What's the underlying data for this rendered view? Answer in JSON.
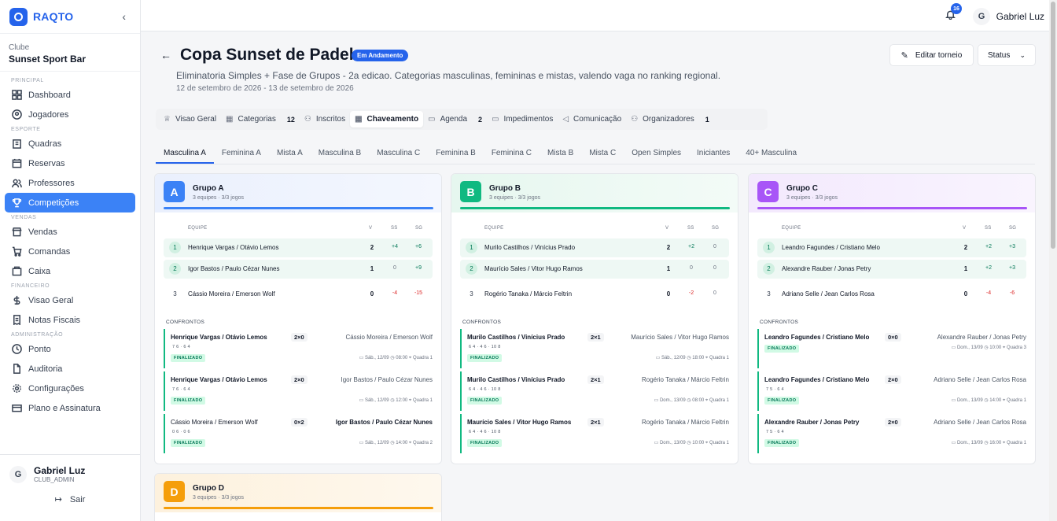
{
  "brand": {
    "name": "RAQTO"
  },
  "club": {
    "label": "Clube",
    "name": "Sunset Sport Bar"
  },
  "nav": {
    "sections": {
      "principal": "PRINCIPAL",
      "esporte": "ESPORTE",
      "vendas": "VENDAS",
      "financeiro": "FINANCEIRO",
      "administracao": "ADMINISTRAÇÃO"
    },
    "items": {
      "dashboard": "Dashboard",
      "jogadores": "Jogadores",
      "quadras": "Quadras",
      "reservas": "Reservas",
      "professores": "Professores",
      "competicoes": "Competições",
      "vendas": "Vendas",
      "comandas": "Comandas",
      "caixa": "Caixa",
      "visao_geral": "Visao Geral",
      "notas_fiscais": "Notas Fiscais",
      "ponto": "Ponto",
      "auditoria": "Auditoria",
      "configuracoes": "Configurações",
      "plano": "Plano e Assinatura"
    }
  },
  "user": {
    "initial": "G",
    "name": "Gabriel Luz",
    "role": "CLUB_ADMIN",
    "logout": "Sair"
  },
  "topbar": {
    "notifications": "16",
    "initial": "G",
    "name": "Gabriel Luz"
  },
  "header": {
    "title": "Copa Sunset de Padel",
    "status": "Em Andamento",
    "description": "Eliminatoria Simples + Fase de Grupos - 2a edicao. Categorias masculinas, femininas e mistas, valendo vaga no ranking regional.",
    "dates": "12 de setembro de 2026 - 13 de setembro de 2026",
    "edit_button": "Editar torneio",
    "status_button": "Status"
  },
  "main_tabs": [
    {
      "label": "Visao Geral",
      "count": ""
    },
    {
      "label": "Categorias",
      "count": "12"
    },
    {
      "label": "Inscritos",
      "count": ""
    },
    {
      "label": "Chaveamento",
      "count": ""
    },
    {
      "label": "Agenda",
      "count": "2"
    },
    {
      "label": "Impedimentos",
      "count": ""
    },
    {
      "label": "Comunicação",
      "count": ""
    },
    {
      "label": "Organizadores",
      "count": "1"
    }
  ],
  "category_tabs": [
    "Masculina A",
    "Feminina A",
    "Mista A",
    "Masculina B",
    "Masculina C",
    "Feminina B",
    "Feminina C",
    "Mista B",
    "Mista C",
    "Open Simples",
    "Iniciantes",
    "40+ Masculina"
  ],
  "table_headers": {
    "team": "EQUIPE",
    "v": "V",
    "ss": "SS",
    "sg": "SG",
    "confrontos": "CONFRONTOS",
    "finalizado": "FINALIZADO"
  },
  "colors": {
    "accent": "#2563eb",
    "groupA": "#3b82f6",
    "groupB": "#10b981",
    "groupC": "#a855f7",
    "groupD": "#f59e0b"
  },
  "groups": [
    {
      "letter": "A",
      "name": "Grupo A",
      "sub": "3 equipes · 3/3 jogos",
      "standings": [
        {
          "pos": "1",
          "team": "Henrique Vargas / Otávio Lemos",
          "v": "2",
          "ss": "+4",
          "sg": "+6"
        },
        {
          "pos": "2",
          "team": "Igor Bastos / Paulo Cézar Nunes",
          "v": "1",
          "ss": "0",
          "sg": "+9"
        },
        {
          "pos": "3",
          "team": "Cássio Moreira / Emerson Wolf",
          "v": "0",
          "ss": "-4",
          "sg": "-15"
        }
      ],
      "matches": [
        {
          "a": "Henrique Vargas / Otávio Lemos",
          "score": "2×0",
          "b": "Cássio Moreira / Emerson Wolf",
          "winner": "a",
          "sets": "7 6 · 6 4",
          "date": "Sáb., 12/09",
          "time": "08:00",
          "court": "Quadra 1"
        },
        {
          "a": "Henrique Vargas / Otávio Lemos",
          "score": "2×0",
          "b": "Igor Bastos / Paulo Cézar Nunes",
          "winner": "a",
          "sets": "7 6 · 6 4",
          "date": "Sáb., 12/09",
          "time": "12:00",
          "court": "Quadra 1"
        },
        {
          "a": "Cássio Moreira / Emerson Wolf",
          "score": "0×2",
          "b": "Igor Bastos / Paulo Cézar Nunes",
          "winner": "b",
          "sets": "0 6 · 0 6",
          "date": "Sáb., 12/09",
          "time": "14:00",
          "court": "Quadra 2"
        }
      ]
    },
    {
      "letter": "B",
      "name": "Grupo B",
      "sub": "3 equipes · 3/3 jogos",
      "standings": [
        {
          "pos": "1",
          "team": "Murilo Castilhos / Vinícius Prado",
          "v": "2",
          "ss": "+2",
          "sg": "0"
        },
        {
          "pos": "2",
          "team": "Maurício Sales / Vitor Hugo Ramos",
          "v": "1",
          "ss": "0",
          "sg": "0"
        },
        {
          "pos": "3",
          "team": "Rogério Tanaka / Márcio Feltrin",
          "v": "0",
          "ss": "-2",
          "sg": "0"
        }
      ],
      "matches": [
        {
          "a": "Murilo Castilhos / Vinícius Prado",
          "score": "2×1",
          "b": "Maurício Sales / Vitor Hugo Ramos",
          "winner": "a",
          "sets": "6 4 · 4 6 · 10 8",
          "date": "Sáb., 12/09",
          "time": "18:00",
          "court": "Quadra 1"
        },
        {
          "a": "Murilo Castilhos / Vinícius Prado",
          "score": "2×1",
          "b": "Rogério Tanaka / Márcio Feltrin",
          "winner": "a",
          "sets": "6 4 · 4 6 · 10 8",
          "date": "Dom., 13/09",
          "time": "08:00",
          "court": "Quadra 1"
        },
        {
          "a": "Maurício Sales / Vitor Hugo Ramos",
          "score": "2×1",
          "b": "Rogério Tanaka / Márcio Feltrin",
          "winner": "a",
          "sets": "6 4 · 4 6 · 10 8",
          "date": "Dom., 13/09",
          "time": "10:00",
          "court": "Quadra 1"
        }
      ]
    },
    {
      "letter": "C",
      "name": "Grupo C",
      "sub": "3 equipes · 3/3 jogos",
      "standings": [
        {
          "pos": "1",
          "team": "Leandro Fagundes / Cristiano Melo",
          "v": "2",
          "ss": "+2",
          "sg": "+3"
        },
        {
          "pos": "2",
          "team": "Alexandre Rauber / Jonas Petry",
          "v": "1",
          "ss": "+2",
          "sg": "+3"
        },
        {
          "pos": "3",
          "team": "Adriano Selle / Jean Carlos Rosa",
          "v": "0",
          "ss": "-4",
          "sg": "-6"
        }
      ],
      "matches": [
        {
          "a": "Leandro Fagundes / Cristiano Melo",
          "score": "0×0",
          "b": "Alexandre Rauber / Jonas Petry",
          "winner": "a",
          "sets": "",
          "date": "Dom., 13/09",
          "time": "10:00",
          "court": "Quadra 3"
        },
        {
          "a": "Leandro Fagundes / Cristiano Melo",
          "score": "2×0",
          "b": "Adriano Selle / Jean Carlos Rosa",
          "winner": "a",
          "sets": "7 5 · 6 4",
          "date": "Dom., 13/09",
          "time": "14:00",
          "court": "Quadra 1"
        },
        {
          "a": "Alexandre Rauber / Jonas Petry",
          "score": "2×0",
          "b": "Adriano Selle / Jean Carlos Rosa",
          "winner": "a",
          "sets": "7 5 · 6 4",
          "date": "Dom., 13/09",
          "time": "16:00",
          "court": "Quadra 1"
        }
      ]
    },
    {
      "letter": "D",
      "name": "Grupo D",
      "sub": "3 equipes · 3/3 jogos"
    }
  ]
}
